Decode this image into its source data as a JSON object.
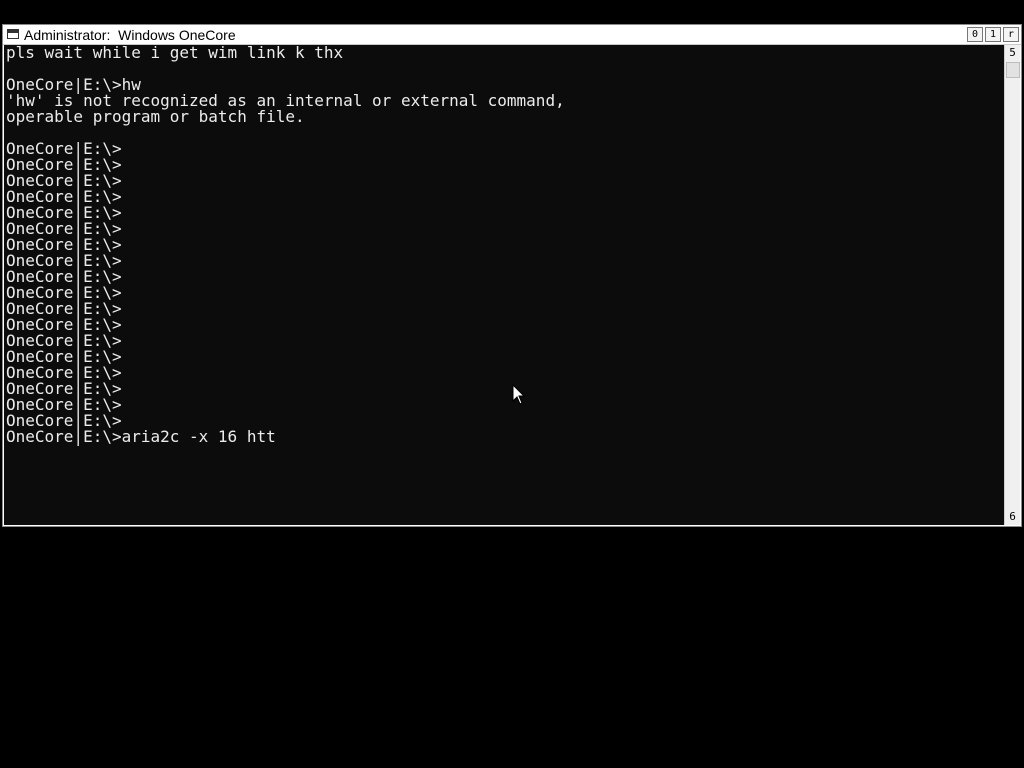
{
  "window": {
    "title": "Administrator:  Windows OneCore",
    "buttons": {
      "minimize": "0",
      "maximize": "1",
      "close": "r"
    }
  },
  "scrollbar": {
    "up_glyph": "5",
    "down_glyph": "6"
  },
  "console": {
    "lines": [
      "pls wait while i get wim link k thx",
      "",
      "OneCore|E:\\>hw",
      "'hw' is not recognized as an internal or external command,",
      "operable program or batch file.",
      "",
      "OneCore|E:\\>",
      "OneCore|E:\\>",
      "OneCore|E:\\>",
      "OneCore|E:\\>",
      "OneCore|E:\\>",
      "OneCore|E:\\>",
      "OneCore|E:\\>",
      "OneCore|E:\\>",
      "OneCore|E:\\>",
      "OneCore|E:\\>",
      "OneCore|E:\\>",
      "OneCore|E:\\>",
      "OneCore|E:\\>",
      "OneCore|E:\\>",
      "OneCore|E:\\>",
      "OneCore|E:\\>",
      "OneCore|E:\\>",
      "OneCore|E:\\>",
      "OneCore|E:\\>aria2c -x 16 htt"
    ]
  },
  "colors": {
    "console_bg": "#0c0c0c",
    "console_fg": "#ececec",
    "desktop_bg": "#000000"
  }
}
